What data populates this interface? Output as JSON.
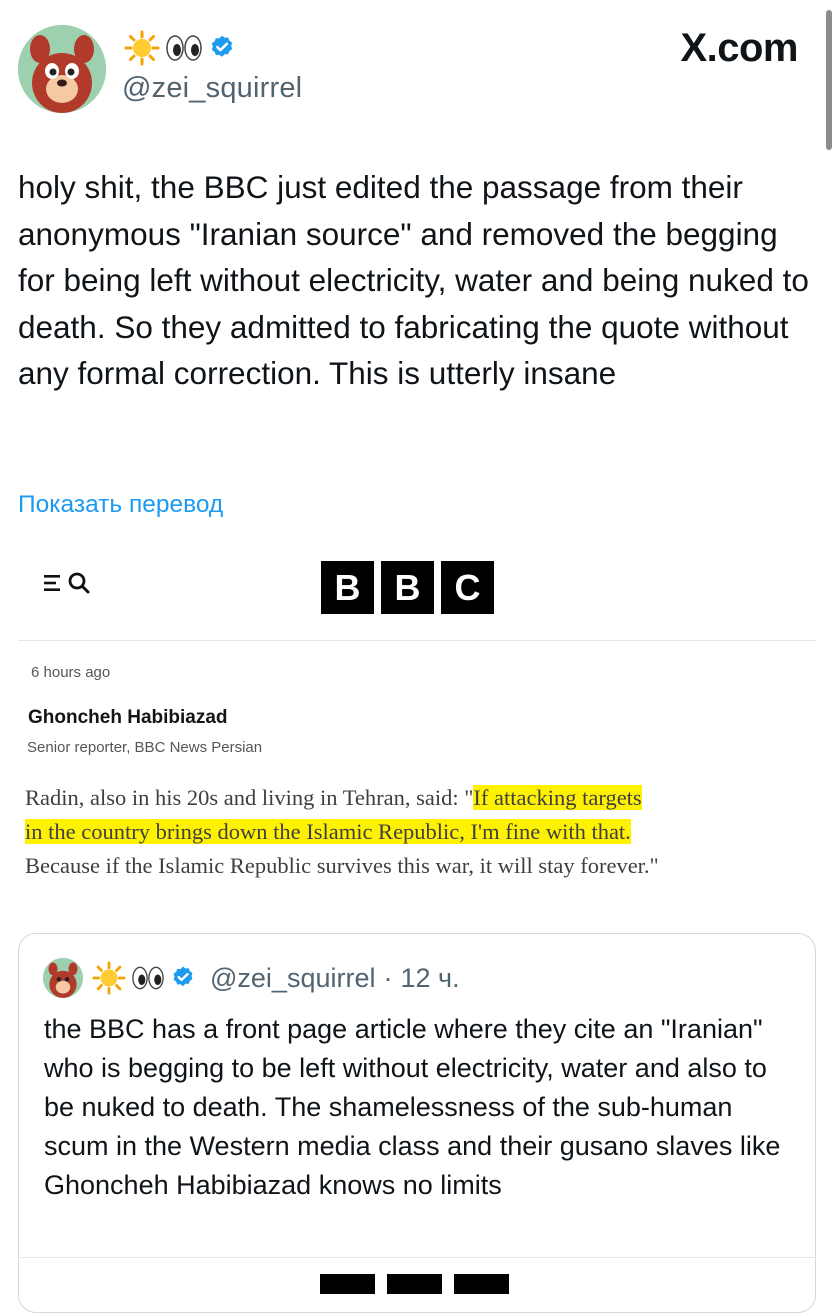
{
  "header": {
    "handle": "@zei_squirrel",
    "site_label": "X.com",
    "emoji_icons": [
      "sun-icon",
      "eyes-icon"
    ],
    "verified_icon": "verified-badge-icon"
  },
  "tweet": {
    "text": "holy shit, the BBC just edited the passage from their anonymous \"Iranian source\" and removed the begging for being left without electricity, water and being nuked to death. So they admitted to fabricating the quote without any formal correction. This is utterly insane",
    "translate_link": "Показать перевод"
  },
  "bbc_screenshot": {
    "logo_letters": [
      "B",
      "B",
      "C"
    ],
    "timestamp": "6 hours ago",
    "author": "Ghoncheh Habibiazad",
    "author_role": "Senior reporter, BBC News Persian",
    "quote_before": "Radin, also in his 20s and living in Tehran, said: \"",
    "quote_highlight_1": "If attacking targets",
    "quote_highlight_2": "in the country brings down the Islamic Republic, I'm fine with that.",
    "quote_after": "Because if the Islamic Republic survives this war, it will stay forever.\""
  },
  "quoted_tweet": {
    "handle": "@zei_squirrel",
    "separator": "·",
    "time": "12 ч.",
    "text": "the BBC has a front page article where they cite an \"Iranian\" who is begging to be left without electricity, water and also to be nuked to death. The shamelessness of the sub-human scum in the Western media class and their gusano slaves like Ghoncheh Habibiazad knows no limits"
  },
  "colors": {
    "link": "#1d9bf0",
    "verified": "#1d9bf0",
    "highlight": "#fff200",
    "muted_text": "#536471"
  }
}
